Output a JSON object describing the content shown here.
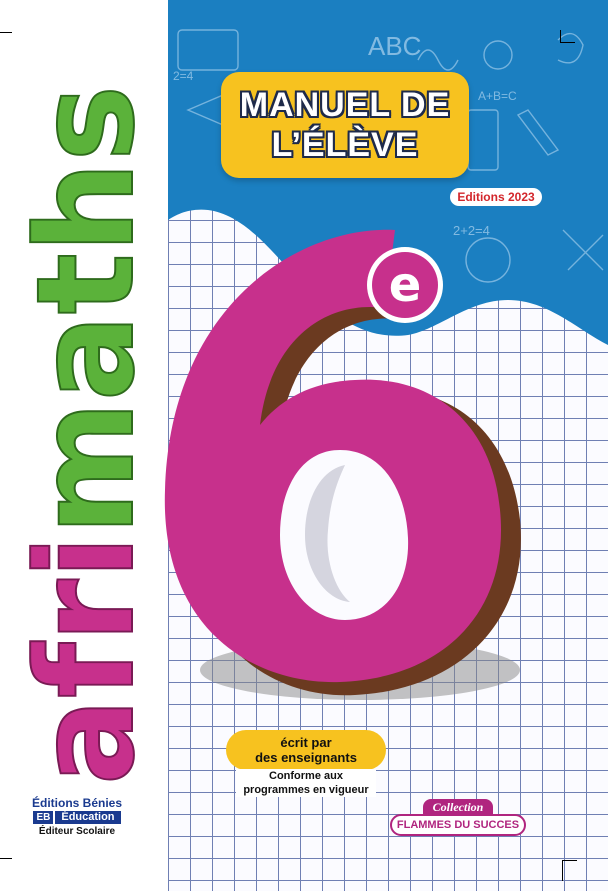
{
  "cover": {
    "series_title": "afrimaths",
    "manual_line1": "MANUEL DE",
    "manual_line2": "L’ÉLÈVE",
    "edition": "Editions 2023",
    "grade_number": "6",
    "grade_suffix": "e",
    "tag_line1": "écrit par",
    "tag_line2": "des enseignants",
    "conform_line1": "Conforme aux",
    "conform_line2": "programmes en vigueur",
    "publisher_name": "Éditions Bénies",
    "publisher_logo": "EB",
    "publisher_edu": "Éducation",
    "publisher_sub": "Éditeur Scolaire",
    "collection_label": "Collection",
    "collection_name": "FLAMMES DU SUCCES",
    "doodles": [
      "ABC",
      "A+B=C",
      "2+2=4",
      "2=4"
    ]
  },
  "colors": {
    "blue": "#1b7fc1",
    "magenta": "#c7308c",
    "green": "#5bb23a",
    "yellow": "#f7c21f",
    "grid": "#6f7fb3"
  }
}
